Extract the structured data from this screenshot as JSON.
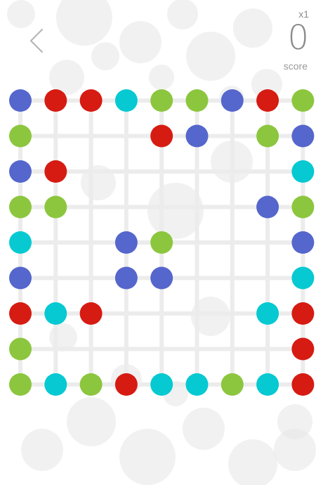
{
  "header": {
    "multiplier": "x1",
    "score": "0",
    "score_label": "score"
  },
  "colors": {
    "R": "#d61b12",
    "G": "#8cc63e",
    "B": "#5566cc",
    "C": "#06c9d2",
    "grid": "#ececec",
    "back_arrow": "#b3b3b3",
    "bokeh": "#e6e6e6"
  },
  "board": {
    "rows": 9,
    "cols": 9,
    "cells": [
      [
        "B",
        "R",
        "R",
        "C",
        "G",
        "G",
        "B",
        "R",
        "G"
      ],
      [
        "G",
        "",
        "",
        "",
        "R",
        "B",
        "",
        "G",
        "B"
      ],
      [
        "B",
        "R",
        "",
        "",
        "",
        "",
        "",
        "",
        "C"
      ],
      [
        "G",
        "G",
        "",
        "",
        "",
        "",
        "",
        "B",
        "G"
      ],
      [
        "C",
        "",
        "",
        "B",
        "G",
        "",
        "",
        "",
        "B"
      ],
      [
        "B",
        "",
        "",
        "B",
        "B",
        "",
        "",
        "",
        "C"
      ],
      [
        "R",
        "C",
        "R",
        "",
        "",
        "",
        "",
        "C",
        "R"
      ],
      [
        "G",
        "",
        "",
        "",
        "",
        "",
        "",
        "",
        "R"
      ],
      [
        "G",
        "C",
        "G",
        "R",
        "C",
        "C",
        "G",
        "C",
        "R"
      ]
    ]
  }
}
